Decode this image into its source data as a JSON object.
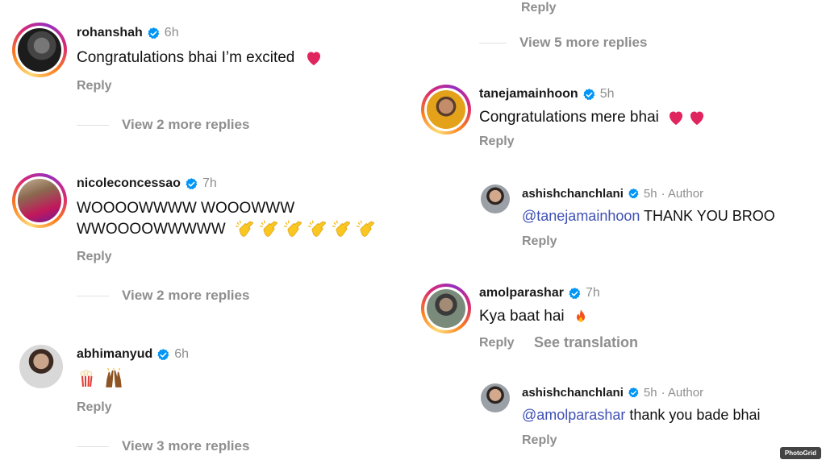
{
  "left": {
    "c1": {
      "username": "rohanshah",
      "time": "6h",
      "text": "Congratulations bhai I’m excited",
      "reply": "Reply",
      "view_more": "View 2 more replies"
    },
    "c2": {
      "username": "nicoleconcessao",
      "time": "7h",
      "text_line1": "WOOOOWWWW WOOOWWW",
      "text_line2": "WWOOOOWWWWW",
      "reply": "Reply",
      "view_more": "View 2 more replies"
    },
    "c3": {
      "username": "abhimanyud",
      "time": "6h",
      "reply": "Reply",
      "view_more": "View 3 more replies"
    }
  },
  "right": {
    "top_reply": "Reply",
    "top_view_more": "View 5 more replies",
    "c1": {
      "username": "tanejamainhoon",
      "time": "5h",
      "text": "Congratulations mere bhai",
      "reply": "Reply"
    },
    "r1": {
      "username": "ashishchanchlani",
      "time": "5h",
      "author": "· Author",
      "mention": "@tanejamainhoon",
      "text": " THANK YOU BROO",
      "reply": "Reply"
    },
    "c2": {
      "username": "amolparashar",
      "time": "7h",
      "text": "Kya baat hai",
      "reply": "Reply",
      "see_translation": "See translation"
    },
    "r2": {
      "username": "ashishchanchlani",
      "time": "5h",
      "author": "· Author",
      "mention": "@amolparashar",
      "text": " thank you bade bhai",
      "reply": "Reply"
    }
  },
  "watermark": "PhotoGrid",
  "colors": {
    "verified": "#0095f6",
    "secondary_text": "#8e8e8e",
    "mention": "#3f51b5",
    "heart": "#e0245e"
  }
}
